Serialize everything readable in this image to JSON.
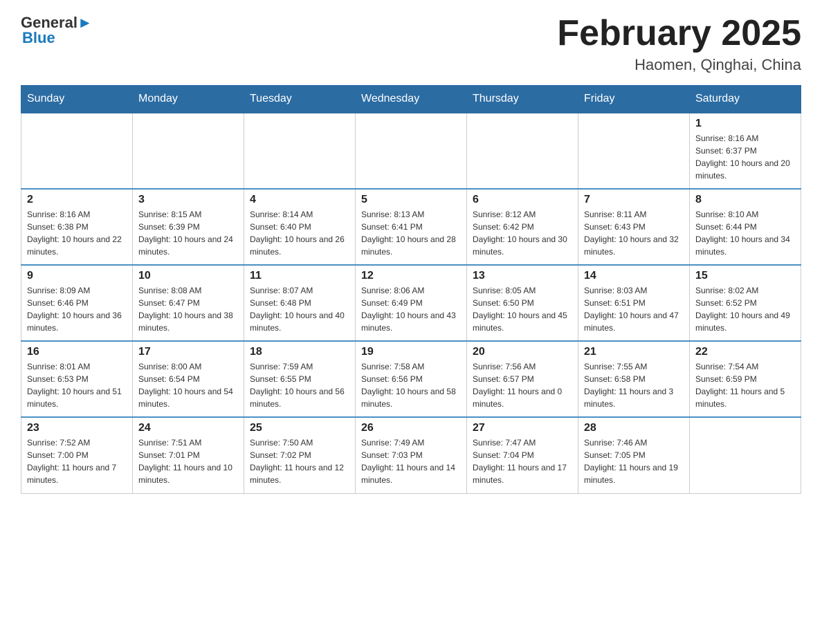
{
  "header": {
    "logo_text_main": "General",
    "logo_text_blue": "Blue",
    "month_title": "February 2025",
    "location": "Haomen, Qinghai, China"
  },
  "days_of_week": [
    "Sunday",
    "Monday",
    "Tuesday",
    "Wednesday",
    "Thursday",
    "Friday",
    "Saturday"
  ],
  "weeks": [
    [
      {
        "day": "",
        "sunrise": "",
        "sunset": "",
        "daylight": ""
      },
      {
        "day": "",
        "sunrise": "",
        "sunset": "",
        "daylight": ""
      },
      {
        "day": "",
        "sunrise": "",
        "sunset": "",
        "daylight": ""
      },
      {
        "day": "",
        "sunrise": "",
        "sunset": "",
        "daylight": ""
      },
      {
        "day": "",
        "sunrise": "",
        "sunset": "",
        "daylight": ""
      },
      {
        "day": "",
        "sunrise": "",
        "sunset": "",
        "daylight": ""
      },
      {
        "day": "1",
        "sunrise": "Sunrise: 8:16 AM",
        "sunset": "Sunset: 6:37 PM",
        "daylight": "Daylight: 10 hours and 20 minutes."
      }
    ],
    [
      {
        "day": "2",
        "sunrise": "Sunrise: 8:16 AM",
        "sunset": "Sunset: 6:38 PM",
        "daylight": "Daylight: 10 hours and 22 minutes."
      },
      {
        "day": "3",
        "sunrise": "Sunrise: 8:15 AM",
        "sunset": "Sunset: 6:39 PM",
        "daylight": "Daylight: 10 hours and 24 minutes."
      },
      {
        "day": "4",
        "sunrise": "Sunrise: 8:14 AM",
        "sunset": "Sunset: 6:40 PM",
        "daylight": "Daylight: 10 hours and 26 minutes."
      },
      {
        "day": "5",
        "sunrise": "Sunrise: 8:13 AM",
        "sunset": "Sunset: 6:41 PM",
        "daylight": "Daylight: 10 hours and 28 minutes."
      },
      {
        "day": "6",
        "sunrise": "Sunrise: 8:12 AM",
        "sunset": "Sunset: 6:42 PM",
        "daylight": "Daylight: 10 hours and 30 minutes."
      },
      {
        "day": "7",
        "sunrise": "Sunrise: 8:11 AM",
        "sunset": "Sunset: 6:43 PM",
        "daylight": "Daylight: 10 hours and 32 minutes."
      },
      {
        "day": "8",
        "sunrise": "Sunrise: 8:10 AM",
        "sunset": "Sunset: 6:44 PM",
        "daylight": "Daylight: 10 hours and 34 minutes."
      }
    ],
    [
      {
        "day": "9",
        "sunrise": "Sunrise: 8:09 AM",
        "sunset": "Sunset: 6:46 PM",
        "daylight": "Daylight: 10 hours and 36 minutes."
      },
      {
        "day": "10",
        "sunrise": "Sunrise: 8:08 AM",
        "sunset": "Sunset: 6:47 PM",
        "daylight": "Daylight: 10 hours and 38 minutes."
      },
      {
        "day": "11",
        "sunrise": "Sunrise: 8:07 AM",
        "sunset": "Sunset: 6:48 PM",
        "daylight": "Daylight: 10 hours and 40 minutes."
      },
      {
        "day": "12",
        "sunrise": "Sunrise: 8:06 AM",
        "sunset": "Sunset: 6:49 PM",
        "daylight": "Daylight: 10 hours and 43 minutes."
      },
      {
        "day": "13",
        "sunrise": "Sunrise: 8:05 AM",
        "sunset": "Sunset: 6:50 PM",
        "daylight": "Daylight: 10 hours and 45 minutes."
      },
      {
        "day": "14",
        "sunrise": "Sunrise: 8:03 AM",
        "sunset": "Sunset: 6:51 PM",
        "daylight": "Daylight: 10 hours and 47 minutes."
      },
      {
        "day": "15",
        "sunrise": "Sunrise: 8:02 AM",
        "sunset": "Sunset: 6:52 PM",
        "daylight": "Daylight: 10 hours and 49 minutes."
      }
    ],
    [
      {
        "day": "16",
        "sunrise": "Sunrise: 8:01 AM",
        "sunset": "Sunset: 6:53 PM",
        "daylight": "Daylight: 10 hours and 51 minutes."
      },
      {
        "day": "17",
        "sunrise": "Sunrise: 8:00 AM",
        "sunset": "Sunset: 6:54 PM",
        "daylight": "Daylight: 10 hours and 54 minutes."
      },
      {
        "day": "18",
        "sunrise": "Sunrise: 7:59 AM",
        "sunset": "Sunset: 6:55 PM",
        "daylight": "Daylight: 10 hours and 56 minutes."
      },
      {
        "day": "19",
        "sunrise": "Sunrise: 7:58 AM",
        "sunset": "Sunset: 6:56 PM",
        "daylight": "Daylight: 10 hours and 58 minutes."
      },
      {
        "day": "20",
        "sunrise": "Sunrise: 7:56 AM",
        "sunset": "Sunset: 6:57 PM",
        "daylight": "Daylight: 11 hours and 0 minutes."
      },
      {
        "day": "21",
        "sunrise": "Sunrise: 7:55 AM",
        "sunset": "Sunset: 6:58 PM",
        "daylight": "Daylight: 11 hours and 3 minutes."
      },
      {
        "day": "22",
        "sunrise": "Sunrise: 7:54 AM",
        "sunset": "Sunset: 6:59 PM",
        "daylight": "Daylight: 11 hours and 5 minutes."
      }
    ],
    [
      {
        "day": "23",
        "sunrise": "Sunrise: 7:52 AM",
        "sunset": "Sunset: 7:00 PM",
        "daylight": "Daylight: 11 hours and 7 minutes."
      },
      {
        "day": "24",
        "sunrise": "Sunrise: 7:51 AM",
        "sunset": "Sunset: 7:01 PM",
        "daylight": "Daylight: 11 hours and 10 minutes."
      },
      {
        "day": "25",
        "sunrise": "Sunrise: 7:50 AM",
        "sunset": "Sunset: 7:02 PM",
        "daylight": "Daylight: 11 hours and 12 minutes."
      },
      {
        "day": "26",
        "sunrise": "Sunrise: 7:49 AM",
        "sunset": "Sunset: 7:03 PM",
        "daylight": "Daylight: 11 hours and 14 minutes."
      },
      {
        "day": "27",
        "sunrise": "Sunrise: 7:47 AM",
        "sunset": "Sunset: 7:04 PM",
        "daylight": "Daylight: 11 hours and 17 minutes."
      },
      {
        "day": "28",
        "sunrise": "Sunrise: 7:46 AM",
        "sunset": "Sunset: 7:05 PM",
        "daylight": "Daylight: 11 hours and 19 minutes."
      },
      {
        "day": "",
        "sunrise": "",
        "sunset": "",
        "daylight": ""
      }
    ]
  ]
}
